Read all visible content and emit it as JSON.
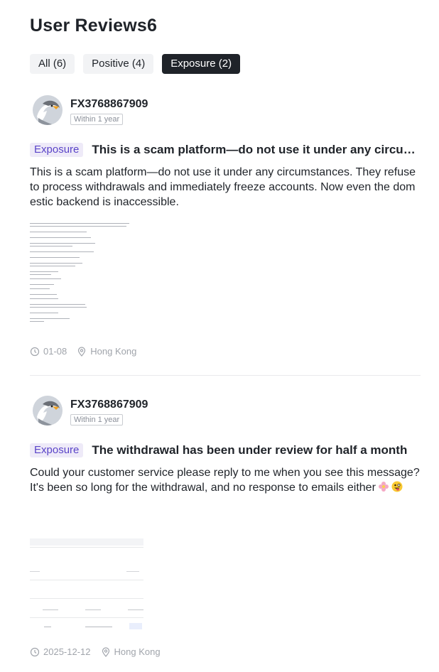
{
  "header": {
    "title": "User Reviews6"
  },
  "tabs": [
    {
      "label": "All (6)",
      "active": false
    },
    {
      "label": "Positive (4)",
      "active": false
    },
    {
      "label": "Exposure (2)",
      "active": true
    }
  ],
  "reviews": [
    {
      "username": "FX3768867909",
      "time_badge": "Within 1 year",
      "tag": "Exposure",
      "title": "This is a scam platform—do not use it under any circumstances.",
      "body": "This is a scam platform—do not use it under any circumstances. They refuse to process withdrawals and immediately freeze accounts. Now even the domestic backend is inaccessible.",
      "date": "01-08",
      "location": "Hong Kong"
    },
    {
      "username": "FX3768867909",
      "time_badge": "Within 1 year",
      "tag": "Exposure",
      "title": "The withdrawal has been under review for half a month",
      "body": "Could your customer service please reply to me when you see this message? It's been so long for the withdrawal, and no response to emails either",
      "date": "2025-12-12",
      "location": "Hong Kong"
    }
  ],
  "colors": {
    "accent_tag_bg": "#eeeaf8",
    "accent_tag_text": "#5a44c8",
    "active_tab_bg": "#1f2329"
  },
  "icons": {
    "avatar": "eagle-avatar-icon",
    "date": "clock-icon",
    "location": "location-pin-icon",
    "emoji_1": "flower-emoji-icon",
    "emoji_2": "tongue-face-emoji-icon"
  }
}
